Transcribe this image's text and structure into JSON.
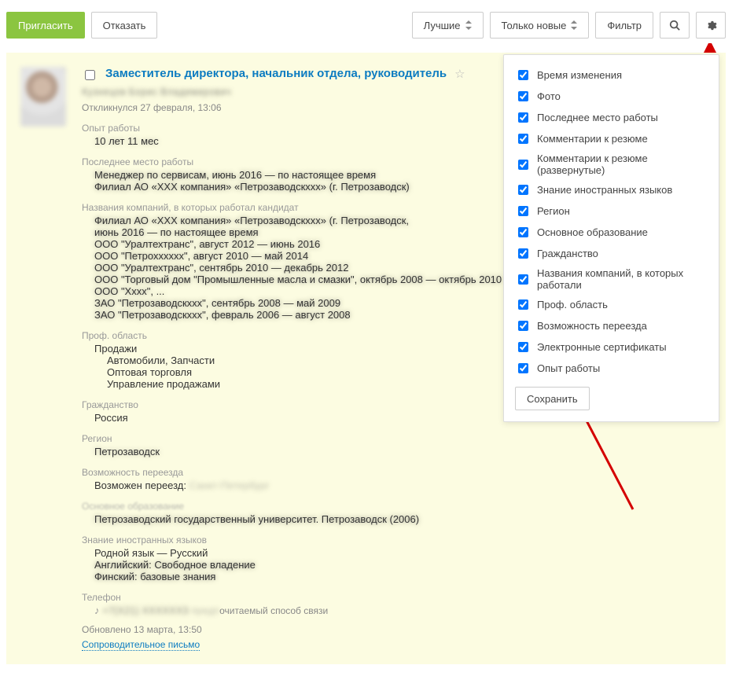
{
  "toolbar": {
    "invite": "Пригласить",
    "reject": "Отказать",
    "best": "Лучшие",
    "only_new": "Только новые",
    "filter": "Фильтр"
  },
  "dropdown": {
    "options": [
      "Время изменения",
      "Фото",
      "Последнее место работы",
      "Комментарии к резюме",
      "Комментарии к резюме (развернутые)",
      "Знание иностранных языков",
      "Регион",
      "Основное образование",
      "Гражданство",
      "Названия компаний, в которых работали",
      "Проф. область",
      "Возможность переезда",
      "Электронные сертификаты",
      "Опыт работы"
    ],
    "save": "Сохранить"
  },
  "resume": {
    "title": "Заместитель директора, начальник отдела, руководитель",
    "name_redacted": "Кузнецов Борис Владимирович",
    "responded": "Откликнулся 27 февраля, 13:06",
    "labels": {
      "experience": "Опыт работы",
      "last_job": "Последнее место работы",
      "companies": "Названия компаний, в которых работал кандидат",
      "prof_area": "Проф. область",
      "citizenship": "Гражданство",
      "region": "Регион",
      "relocation": "Возможность переезда",
      "education": "Основное образование",
      "languages": "Знание иностранных языков",
      "phone": "Телефон"
    },
    "prof_area": "Продажи",
    "prof_sub": [
      "Автомобили, Запчасти",
      "Оптовая торговля",
      "Управление продажами"
    ],
    "citizenship": "Россия",
    "relocation_prefix": "Возможен переезд:",
    "language_native": "Родной язык — Русский",
    "phone_suffix": "очитаемый способ связи",
    "updated": "Обновлено 13 марта, 13:50",
    "cover_letter": "Сопроводительное письмо"
  }
}
